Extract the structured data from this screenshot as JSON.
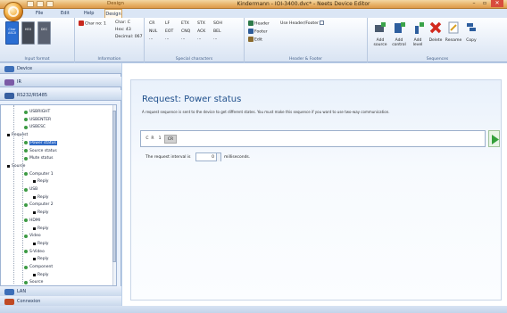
{
  "window": {
    "title": "Kindermann - IOI-3400.dvc* - Neets Device Editor",
    "context_tab": "Design",
    "controls": [
      "–",
      "▫",
      "✕"
    ]
  },
  "menu": {
    "items": [
      "File",
      "Edit",
      "Help",
      "Design"
    ],
    "active": "Design"
  },
  "ribbon": {
    "groups": {
      "input_format": {
        "label": "Input format",
        "buttons": [
          "Char ASCII",
          "HEX",
          "DEC"
        ],
        "colors": [
          "#2b6ed2",
          "#444a55",
          "#5a6170"
        ]
      },
      "information": {
        "label": "Information",
        "char_no": "Char no: 1",
        "char": "Char: C",
        "hex": "Hex: 43",
        "decimal": "Decimal: 067"
      },
      "special_characters": {
        "label": "Special characters",
        "rows": [
          [
            "CR",
            "LF",
            "ETX",
            "STX",
            "SOH"
          ],
          [
            "NUL",
            "EOT",
            "CNQ",
            "ACK",
            "BEL"
          ],
          [
            "···",
            "···",
            "···",
            "···",
            "···"
          ]
        ]
      },
      "header_footer": {
        "label": "Header & Footer",
        "items": [
          "Header",
          "Footer",
          "Edit"
        ],
        "use_label": "Use Header/Footer"
      },
      "sequences": {
        "label": "Sequences",
        "buttons": [
          "Add source",
          "Add control",
          "Add level",
          "Delete",
          "Rename",
          "Copy"
        ]
      }
    }
  },
  "left": {
    "categories_top": [
      {
        "label": "Device",
        "color": "#3d6fb8"
      },
      {
        "label": "IR",
        "color": "#7b5aa6"
      },
      {
        "label": "RS232/RS485",
        "color": "#375fa0"
      }
    ],
    "categories_bottom": [
      {
        "label": "LAN",
        "color": "#3d6fb8"
      },
      {
        "label": "Connexion",
        "color": "#c04a24"
      }
    ],
    "tree": [
      {
        "label": "USBRIGHT",
        "kind": "leaf"
      },
      {
        "label": "USBENTER",
        "kind": "leaf"
      },
      {
        "label": "USBESC",
        "kind": "leaf"
      },
      {
        "label": "Request",
        "kind": "group"
      },
      {
        "label": "Power status",
        "kind": "selected"
      },
      {
        "label": "Source status",
        "kind": "leaf"
      },
      {
        "label": "Mute status",
        "kind": "leaf"
      },
      {
        "label": "Source",
        "kind": "group"
      },
      {
        "label": "Computer 1",
        "kind": "leaf"
      },
      {
        "label": "Reply",
        "kind": "reply"
      },
      {
        "label": "USB",
        "kind": "leaf"
      },
      {
        "label": "Reply",
        "kind": "reply"
      },
      {
        "label": "Computer 2",
        "kind": "leaf"
      },
      {
        "label": "Reply",
        "kind": "reply"
      },
      {
        "label": "HDMI",
        "kind": "leaf"
      },
      {
        "label": "Reply",
        "kind": "reply"
      },
      {
        "label": "Video",
        "kind": "leaf"
      },
      {
        "label": "Reply",
        "kind": "reply"
      },
      {
        "label": "S-Video",
        "kind": "leaf"
      },
      {
        "label": "Reply",
        "kind": "reply"
      },
      {
        "label": "Component",
        "kind": "leaf"
      },
      {
        "label": "Reply",
        "kind": "reply"
      },
      {
        "label": "Source",
        "kind": "leaf"
      }
    ]
  },
  "main": {
    "title": "Request: Power status",
    "description": "A request sequence is sent to the device to get different states. You must make this sequence if you want to use two-way communication.",
    "sequence": [
      "C",
      "R",
      "1",
      "CR"
    ],
    "interval_label": "The request interval is",
    "interval_value": "0",
    "interval_unit": "milliseconds."
  }
}
